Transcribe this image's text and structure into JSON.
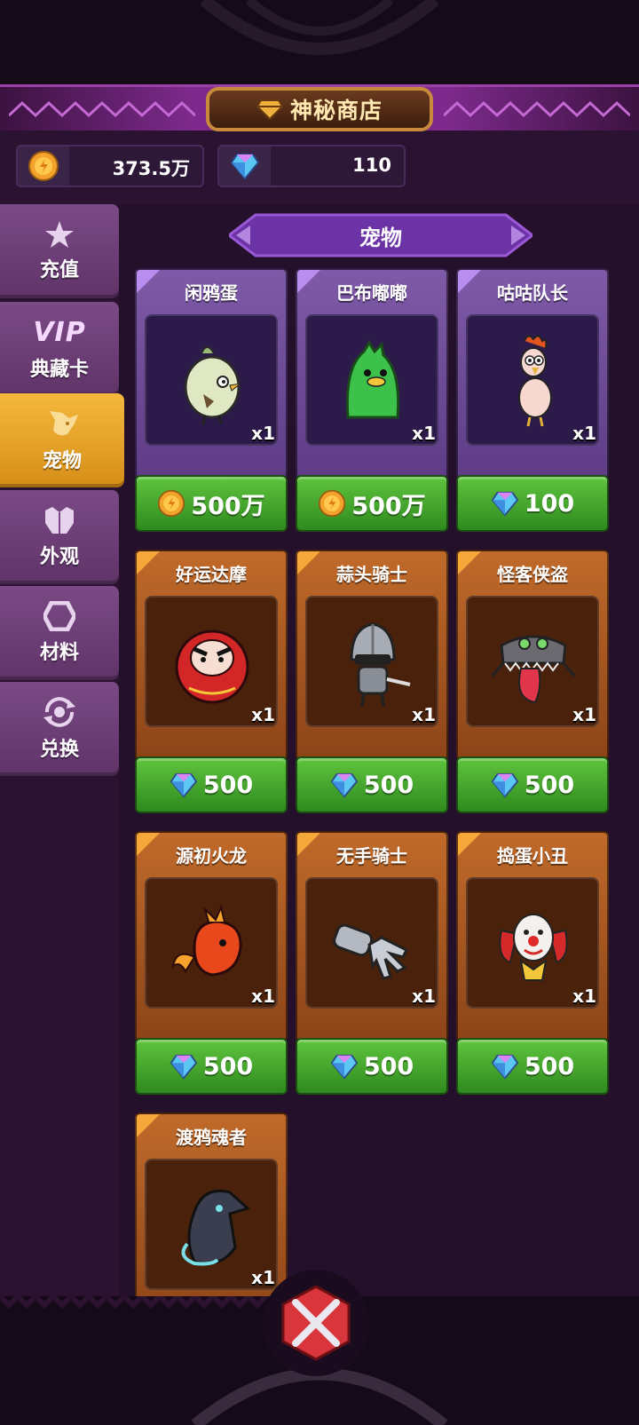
{
  "shop": {
    "title": "神秘商店",
    "title_icon": "diamond-icon"
  },
  "currency": {
    "coins": {
      "icon": "gold-coin-icon",
      "value": "373.5万"
    },
    "gems": {
      "icon": "gem-icon",
      "value": "110"
    }
  },
  "sidebar": {
    "items": [
      {
        "id": "recharge",
        "icon": "star-icon",
        "label": "充值",
        "active": false
      },
      {
        "id": "vip",
        "icon": "vip-text",
        "vip_text": "VIP",
        "label": "典藏卡",
        "active": false
      },
      {
        "id": "pet",
        "icon": "pet-dog-icon",
        "label": "宠物",
        "active": true
      },
      {
        "id": "outfit",
        "icon": "armor-icon",
        "label": "外观",
        "active": false
      },
      {
        "id": "material",
        "icon": "hexagon-icon",
        "label": "材料",
        "active": false
      },
      {
        "id": "exchange",
        "icon": "exchange-icon",
        "label": "兑换",
        "active": false
      }
    ]
  },
  "category": {
    "label": "宠物"
  },
  "items": [
    {
      "name": "闲鸦蛋",
      "qty": "x1",
      "rarity": "purple",
      "currency": "coin",
      "price": "500万",
      "pet": "egg-bird"
    },
    {
      "name": "巴布嘟嘟",
      "qty": "x1",
      "rarity": "purple",
      "currency": "coin",
      "price": "500万",
      "pet": "green-blob"
    },
    {
      "name": "咕咕队长",
      "qty": "x1",
      "rarity": "purple",
      "currency": "gem",
      "price": "100",
      "pet": "chicken"
    },
    {
      "name": "好运达摩",
      "qty": "x1",
      "rarity": "orange",
      "currency": "gem",
      "price": "500",
      "pet": "daruma"
    },
    {
      "name": "蒜头骑士",
      "qty": "x1",
      "rarity": "orange",
      "currency": "gem",
      "price": "500",
      "pet": "knight"
    },
    {
      "name": "怪客侠盗",
      "qty": "x1",
      "rarity": "orange",
      "currency": "gem",
      "price": "500",
      "pet": "mimic"
    },
    {
      "name": "源初火龙",
      "qty": "x1",
      "rarity": "orange",
      "currency": "gem",
      "price": "500",
      "pet": "fire-dragon"
    },
    {
      "name": "无手骑士",
      "qty": "x1",
      "rarity": "orange",
      "currency": "gem",
      "price": "500",
      "pet": "gauntlet"
    },
    {
      "name": "捣蛋小丑",
      "qty": "x1",
      "rarity": "orange",
      "currency": "gem",
      "price": "500",
      "pet": "clown"
    },
    {
      "name": "渡鸦魂者",
      "qty": "x1",
      "rarity": "orange",
      "currency": "gem",
      "price": "",
      "pet": "raven"
    }
  ],
  "close": {
    "icon": "crossed-swords-close-icon"
  }
}
